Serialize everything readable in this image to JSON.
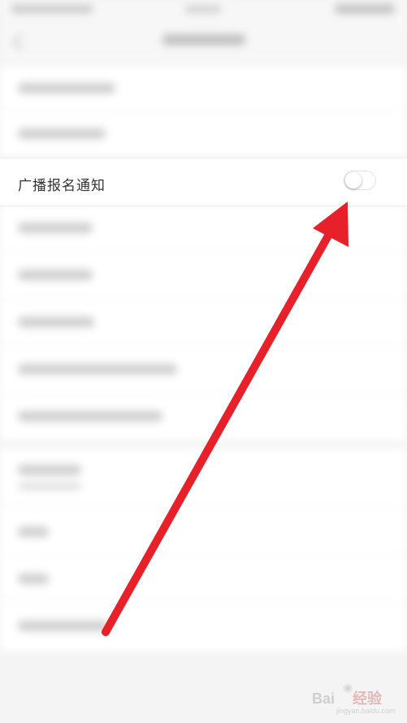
{
  "setting_row": {
    "label": "广播报名通知",
    "toggle_on": false
  },
  "watermark": {
    "brand_a": "Bai",
    "brand_b": "经验",
    "url": "jingyan.baidu.com"
  },
  "colors": {
    "arrow": "#e8202a",
    "background": "#f4f4f4",
    "row_background": "#ffffff",
    "label_text": "#333333"
  },
  "icons": {
    "back": "chevron-left-icon",
    "watermark_logo": "paw-icon"
  }
}
